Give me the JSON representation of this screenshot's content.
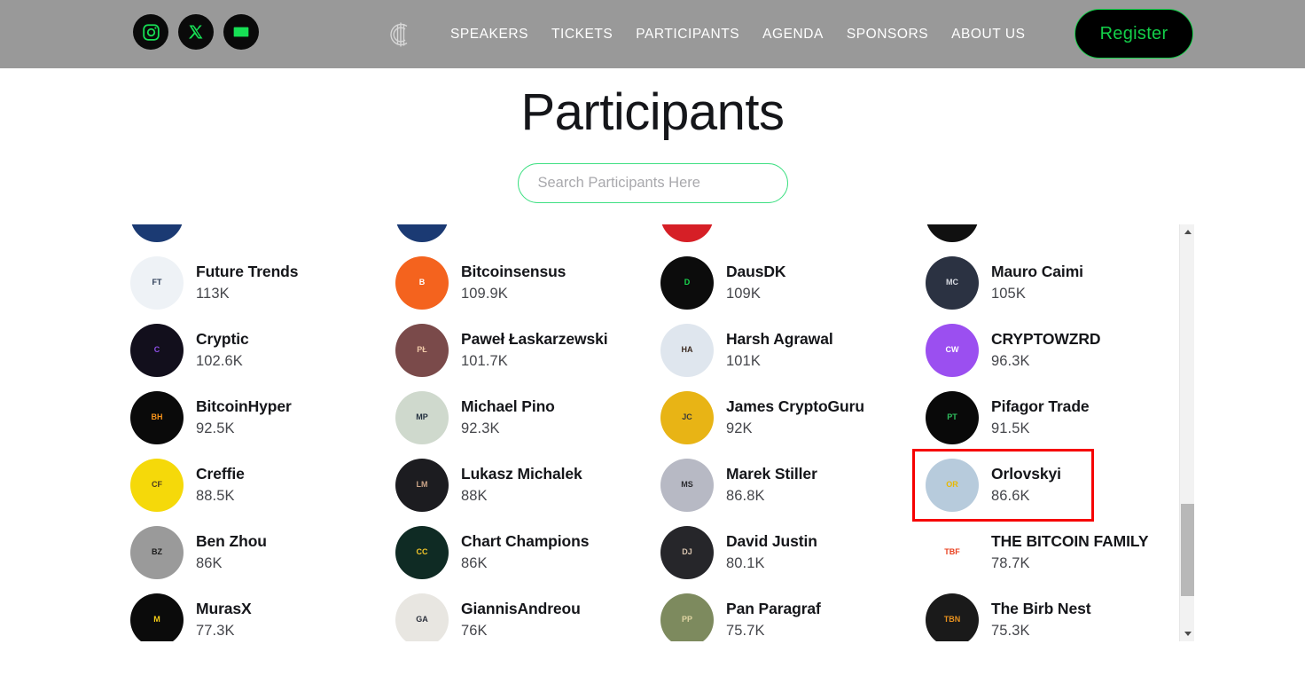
{
  "header": {
    "social": [
      {
        "name": "instagram",
        "label": "Instagram"
      },
      {
        "name": "x-twitter",
        "label": "X"
      },
      {
        "name": "email",
        "label": "Email"
      }
    ],
    "logo_text": "C",
    "nav": [
      {
        "label": "SPEAKERS"
      },
      {
        "label": "TICKETS"
      },
      {
        "label": "PARTICIPANTS"
      },
      {
        "label": "AGENDA"
      },
      {
        "label": "SPONSORS"
      },
      {
        "label": "ABOUT US"
      }
    ],
    "register_label": "Register",
    "bg_color": "#999999",
    "accent_color": "#14d34a"
  },
  "page": {
    "title": "Participants"
  },
  "search": {
    "value": "",
    "placeholder": "Search Participants Here",
    "border_color": "#3fe083"
  },
  "selection": {
    "highlight_color": "#f60000",
    "selected_name": "Orlovskyi"
  },
  "scrollbar": {
    "up_arrow": "▲",
    "down_arrow": "▼"
  },
  "participants": [
    {
      "name": "Future Trends",
      "count": "113K",
      "avatar": "photo",
      "bg": "#eef2f6",
      "fg": "#2b3b55",
      "initials": "FT",
      "selected": false
    },
    {
      "name": "Bitcoinsensus",
      "count": "109.9K",
      "avatar": "logo",
      "bg": "#f4631e",
      "fg": "#ffffff",
      "initials": "B",
      "selected": false
    },
    {
      "name": "DausDK",
      "count": "109K",
      "avatar": "logo",
      "bg": "#0c0c0c",
      "fg": "#18d94f",
      "initials": "D",
      "selected": false
    },
    {
      "name": "Mauro Caimi",
      "count": "105K",
      "avatar": "photo",
      "bg": "#2b3242",
      "fg": "#d8dbe2",
      "initials": "MC",
      "selected": false
    },
    {
      "name": "Cryptic",
      "count": "102.6K",
      "avatar": "logo",
      "bg": "#120f1c",
      "fg": "#8e4fe8",
      "initials": "C",
      "selected": false
    },
    {
      "name": "Paweł Łaskarzewski",
      "count": "101.7K",
      "avatar": "pixel",
      "bg": "#7a4a4a",
      "fg": "#f0c9a8",
      "initials": "PŁ",
      "selected": false
    },
    {
      "name": "Harsh Agrawal",
      "count": "101K",
      "avatar": "photo",
      "bg": "#dfe6ee",
      "fg": "#3c2b21",
      "initials": "HA",
      "selected": false
    },
    {
      "name": "CRYPTOWZRD",
      "count": "96.3K",
      "avatar": "logo",
      "bg": "#9b4ff0",
      "fg": "#ffffff",
      "initials": "CW",
      "selected": false
    },
    {
      "name": "BitcoinHyper",
      "count": "92.5K",
      "avatar": "logo",
      "bg": "#0a0a0a",
      "fg": "#f7931a",
      "initials": "BH",
      "selected": false
    },
    {
      "name": "Michael Pino",
      "count": "92.3K",
      "avatar": "photo",
      "bg": "#cfd9cd",
      "fg": "#23303f",
      "initials": "MP",
      "selected": false
    },
    {
      "name": "James CryptoGuru",
      "count": "92K",
      "avatar": "photo",
      "bg": "#e8b415",
      "fg": "#3a3a3a",
      "initials": "JC",
      "selected": false
    },
    {
      "name": "Pifagor Trade",
      "count": "91.5K",
      "avatar": "logo",
      "bg": "#090909",
      "fg": "#2fbf5e",
      "initials": "PT",
      "selected": false
    },
    {
      "name": "Creffie",
      "count": "88.5K",
      "avatar": "photo",
      "bg": "#f5d90a",
      "fg": "#4b3a20",
      "initials": "CF",
      "selected": false
    },
    {
      "name": "Lukasz Michalek",
      "count": "88K",
      "avatar": "photo",
      "bg": "#1c1c20",
      "fg": "#caa488",
      "initials": "LM",
      "selected": false
    },
    {
      "name": "Marek Stiller",
      "count": "86.8K",
      "avatar": "photo",
      "bg": "#b7b9c4",
      "fg": "#2a2a2e",
      "initials": "MS",
      "selected": false
    },
    {
      "name": "Orlovskyi",
      "count": "86.6K",
      "avatar": "photo",
      "bg": "#b7cbdc",
      "fg": "#e8b800",
      "initials": "OR",
      "selected": true
    },
    {
      "name": "Ben Zhou",
      "count": "86K",
      "avatar": "photo",
      "bg": "#9a9a9a",
      "fg": "#1b1b1b",
      "initials": "BZ",
      "selected": false
    },
    {
      "name": "Chart Champions",
      "count": "86K",
      "avatar": "logo",
      "bg": "#0f2b24",
      "fg": "#f3c62a",
      "initials": "CC",
      "selected": false
    },
    {
      "name": "David Justin",
      "count": "80.1K",
      "avatar": "photo",
      "bg": "#26262a",
      "fg": "#d7c3ae",
      "initials": "DJ",
      "selected": false
    },
    {
      "name": "THE BITCOIN FAMILY",
      "count": "78.7K",
      "avatar": "square",
      "bg": "#ffffff",
      "fg": "#e8401f",
      "initials": "TBF",
      "selected": false
    },
    {
      "name": "MurasX",
      "count": "77.3K",
      "avatar": "logo",
      "bg": "#0b0b0b",
      "fg": "#f5cd17",
      "initials": "M",
      "selected": false
    },
    {
      "name": "GiannisAndreou",
      "count": "76K",
      "avatar": "photo",
      "bg": "#e8e6e1",
      "fg": "#2a2f3a",
      "initials": "GA",
      "selected": false
    },
    {
      "name": "Pan Paragraf",
      "count": "75.7K",
      "avatar": "logo",
      "bg": "#7d8a5e",
      "fg": "#e0d4a2",
      "initials": "PP",
      "selected": false
    },
    {
      "name": "The Birb Nest",
      "count": "75.3K",
      "avatar": "logo",
      "bg": "#1a1a1a",
      "fg": "#e8921f",
      "initials": "TBN",
      "selected": false
    }
  ],
  "partial_top_row": [
    {
      "bg": "#1b3a73",
      "fg": "#f2b01e"
    },
    {
      "bg": "#1b3a73",
      "fg": "#ffffff"
    },
    {
      "bg": "#d61f26",
      "fg": "#1a1a1a"
    },
    {
      "bg": "#101010",
      "fg": "#ffffff"
    }
  ]
}
